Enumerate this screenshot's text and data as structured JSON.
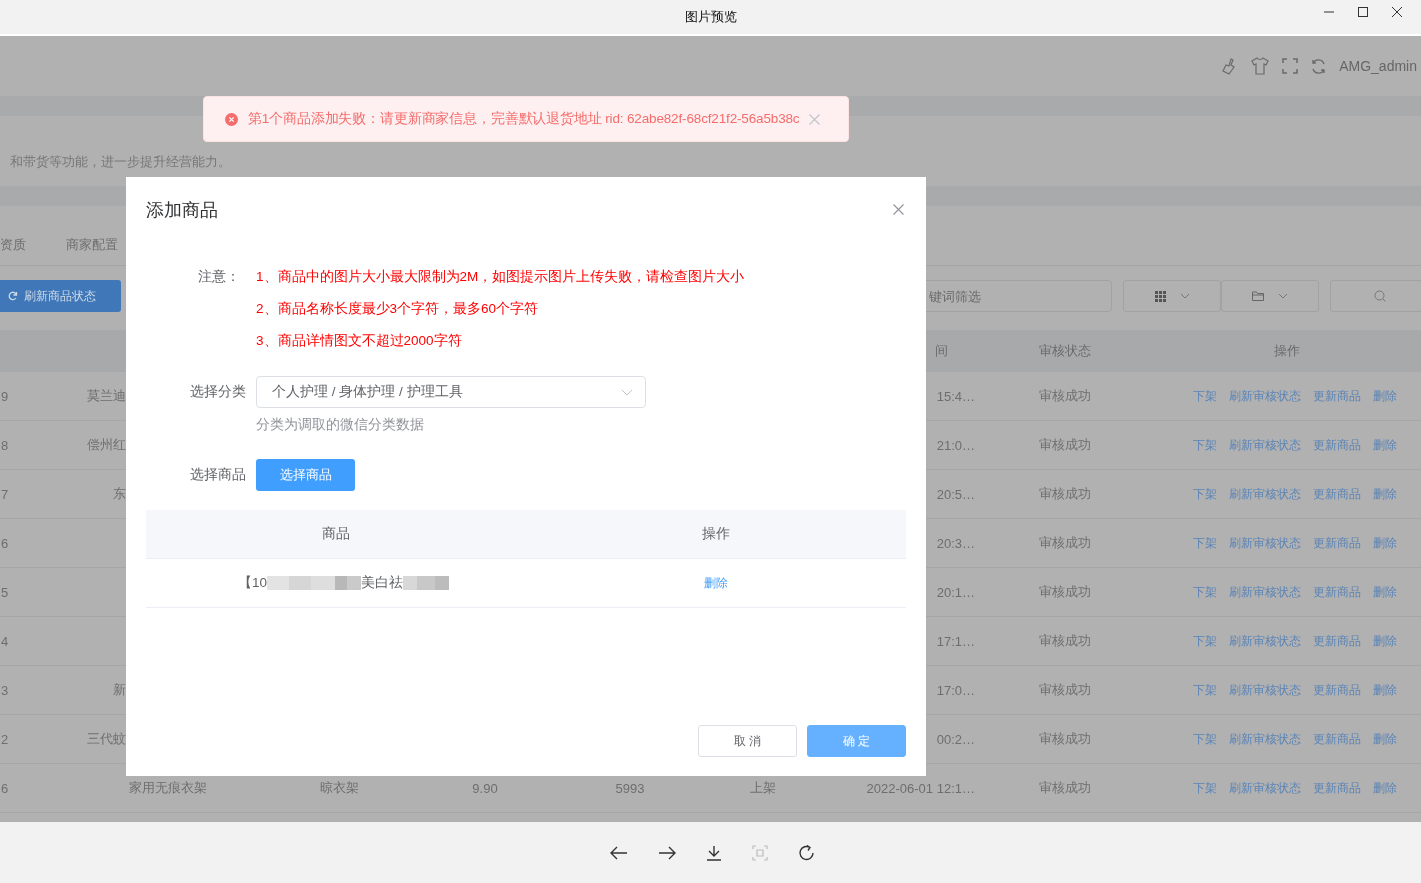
{
  "window": {
    "title": "图片预览"
  },
  "header": {
    "user": "AMG_admin"
  },
  "toast": {
    "kind": "error",
    "message": "第1个商品添加失败：请更新商家信息，完善默认退货地址 rid: 62abe82f-68cf21f2-56a5b38c"
  },
  "page": {
    "intro": "和带货等功能，进一步提升经营能力。",
    "tabs": [
      {
        "label": "资质",
        "selected": false
      },
      {
        "label": "商家配置",
        "selected": false
      }
    ],
    "refresh_button": "刷新商品状态",
    "search": {
      "placeholder": "键词筛选"
    }
  },
  "table": {
    "columns": [
      "间",
      "审核状态",
      "操作"
    ],
    "rows": [
      {
        "id": "9",
        "name": "莫兰迪",
        "clipped": true,
        "time": "15:4…",
        "status": "审核成功",
        "actions": [
          "下架",
          "刷新审核状态",
          "更新商品",
          "删除"
        ]
      },
      {
        "id": "8",
        "name": "偿州红",
        "clipped": true,
        "time": "21:0…",
        "status": "审核成功",
        "actions": [
          "下架",
          "刷新审核状态",
          "更新商品",
          "删除"
        ]
      },
      {
        "id": "7",
        "name": "东",
        "clipped": true,
        "time": "20:5…",
        "status": "审核成功",
        "actions": [
          "下架",
          "刷新审核状态",
          "更新商品",
          "删除"
        ]
      },
      {
        "id": "6",
        "time": "20:3…",
        "status": "审核成功",
        "actions": [
          "下架",
          "刷新审核状态",
          "更新商品",
          "删除"
        ]
      },
      {
        "id": "5",
        "time": "20:1…",
        "status": "审核成功",
        "actions": [
          "下架",
          "刷新审核状态",
          "更新商品",
          "删除"
        ]
      },
      {
        "id": "4",
        "time": "17:1…",
        "status": "审核成功",
        "actions": [
          "下架",
          "刷新审核状态",
          "更新商品",
          "删除"
        ]
      },
      {
        "id": "3",
        "name": "新",
        "clipped": true,
        "time": "17:0…",
        "status": "审核成功",
        "actions": [
          "下架",
          "刷新审核状态",
          "更新商品",
          "删除"
        ]
      },
      {
        "id": "2",
        "name": "三代蚊",
        "clipped": true,
        "time": "00:2…",
        "status": "审核成功",
        "actions": [
          "下架",
          "刷新审核状态",
          "更新商品",
          "删除"
        ]
      },
      {
        "id": "6",
        "name": "家用无痕衣架",
        "category": "晾衣架",
        "price": "9.90",
        "stock": "5993",
        "shelf": "上架",
        "time": "2022-06-01 12:1…",
        "status": "审核成功",
        "actions": [
          "下架",
          "刷新审核状态",
          "更新商品",
          "删除"
        ]
      }
    ]
  },
  "dialog": {
    "title": "添加商品",
    "notes_label": "注意：",
    "notes": [
      "1、商品中的图片大小最大限制为2M，如图提示图片上传失败，请检查图片大小",
      "2、商品名称长度最少3个字符，最多60个字符",
      "3、商品详情图文不超过2000字符"
    ],
    "fields": [
      {
        "kind": "select",
        "label": "选择分类",
        "value": "个人护理 / 身体护理 / 护理工具",
        "hint": "分类为调取的微信分类数据"
      },
      {
        "kind": "button",
        "label": "选择商品",
        "button": "选择商品"
      }
    ],
    "table": {
      "columns": [
        "商品",
        "操作"
      ],
      "rows": [
        {
          "product": [
            {
              "text": "【10",
              "redacted_after": true
            },
            {
              "text": "美白祛",
              "redacted_after": true
            }
          ],
          "action": "删除"
        }
      ]
    },
    "buttons": [
      {
        "label": "取 消",
        "kind": "default"
      },
      {
        "label": "确 定",
        "kind": "primary"
      }
    ]
  },
  "viewer_tools": [
    {
      "kind": "prev",
      "disabled": false
    },
    {
      "kind": "next",
      "disabled": false
    },
    {
      "kind": "download",
      "disabled": false
    },
    {
      "kind": "fit",
      "disabled": true
    },
    {
      "kind": "rotate",
      "disabled": false
    }
  ]
}
